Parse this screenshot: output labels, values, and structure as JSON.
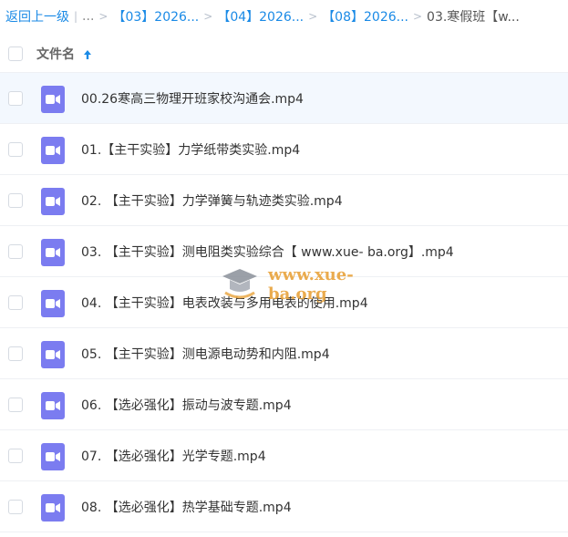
{
  "breadcrumb": {
    "back": "返回上一级",
    "divider": "|",
    "ellipsis": "...",
    "separator": ">",
    "links": [
      "【03】2026...",
      "【04】2026...",
      "【08】2026..."
    ],
    "current": "03.寒假班【w..."
  },
  "header": {
    "column_label": "文件名",
    "sort_icon": "arrow-up-icon"
  },
  "files": [
    {
      "name": "00.26寒高三物理开班家校沟通会.mp4",
      "icon": "video-icon"
    },
    {
      "name": "01.【主干实验】力学纸带类实验.mp4",
      "icon": "video-icon"
    },
    {
      "name": "02. 【主干实验】力学弹簧与轨迹类实验.mp4",
      "icon": "video-icon"
    },
    {
      "name": "03. 【主干实验】测电阻类实验综合【 www.xue- ba.org】.mp4",
      "icon": "video-icon"
    },
    {
      "name": "04. 【主干实验】电表改装与多用电表的使用.mp4",
      "icon": "video-icon"
    },
    {
      "name": "05. 【主干实验】测电源电动势和内阻.mp4",
      "icon": "video-icon"
    },
    {
      "name": "06. 【选必强化】振动与波专题.mp4",
      "icon": "video-icon"
    },
    {
      "name": "07. 【选必强化】光学专题.mp4",
      "icon": "video-icon"
    },
    {
      "name": "08. 【选必强化】热学基础专题.mp4",
      "icon": "video-icon"
    }
  ],
  "watermark": {
    "text": "www.xue-ba.org"
  },
  "colors": {
    "link": "#1a8ae6",
    "video_icon": "#7b7cf0",
    "row_highlight": "#f3f8fe"
  }
}
